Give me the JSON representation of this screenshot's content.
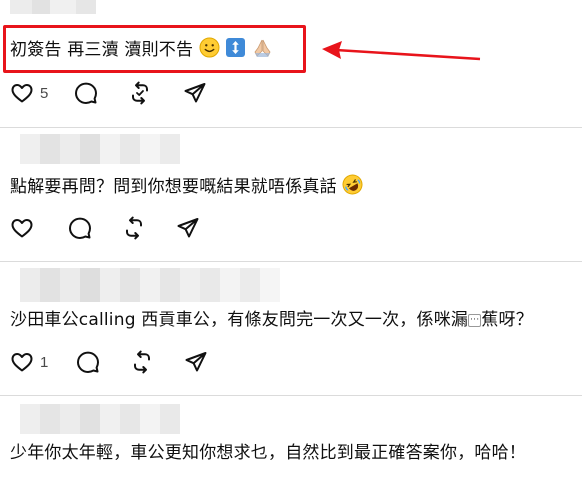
{
  "accent_color": "#e8141b",
  "comments": [
    {
      "text": "初簽告 再三瀆 瀆則不告",
      "emojis": [
        "slightly-smiling-face-icon",
        "up-down-arrow-icon",
        "folded-hands-icon"
      ],
      "like_count": "5"
    },
    {
      "text": "點解要再問？問到你想要嘅結果就唔係真話",
      "emojis": [
        "rolling-on-floor-laughing-icon"
      ],
      "like_count": ""
    },
    {
      "text": "沙田車公calling 西貢車公，有條友問完一次又一次，係咪漏",
      "text_suffix": "蕉呀？",
      "ellipsis_badge": "···",
      "like_count": "1"
    },
    {
      "text": "少年你太年輕，車公更知你想求乜，自然比到最正確答案你，哈哈！",
      "like_count": ""
    }
  ],
  "icons": {
    "like": "heart-icon",
    "reply": "comment-bubble-icon",
    "repost": "repost-icon",
    "share": "send-icon"
  }
}
